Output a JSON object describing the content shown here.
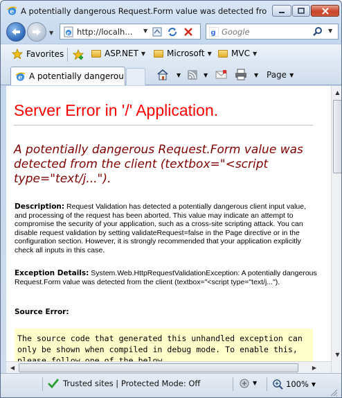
{
  "window": {
    "title": "A potentially dangerous Request.Form value was detected from th..."
  },
  "address_bar": {
    "url": "http://localh...",
    "search_placeholder": "Google"
  },
  "favorites_bar": {
    "favorites_label": "Favorites",
    "items": [
      {
        "label": "ASP.NET",
        "icon": "folder-icon"
      },
      {
        "label": "Microsoft",
        "icon": "folder-icon"
      },
      {
        "label": "MVC",
        "icon": "folder-icon"
      }
    ]
  },
  "tabs": [
    {
      "label": "A potentially dangerous...",
      "active": true
    }
  ],
  "command_bar": {
    "page_label": "Page"
  },
  "page": {
    "heading": "Server Error in '/' Application.",
    "exception_title": "A potentially dangerous Request.Form value was detected from the client (textbox=\"<script type=\"text/j...\").",
    "description_label": "Description:",
    "description_text": "Request Validation has detected a potentially dangerous client input value, and processing of the request has been aborted. This value may indicate an attempt to compromise the security of your application, such as a cross-site scripting attack. You can disable request validation by setting validateRequest=false in the Page directive or in the configuration section. However, it is strongly recommended that your application explicitly check all inputs in this case.",
    "exception_details_label": "Exception Details:",
    "exception_details_text": "System.Web.HttpRequestValidationException: A potentially dangerous Request.Form value was detected from the client (textbox=\"<script type=\"text/j...\").",
    "source_error_label": "Source Error:",
    "source_error_text": "The source code that generated this unhandled exception can only be shown when compiled in debug mode. To enable this, please follow one of the below"
  },
  "status_bar": {
    "zone_text": "Trusted sites | Protected Mode: Off",
    "zoom": "100%"
  },
  "colors": {
    "heading_red": "#ff0000",
    "exception_maroon": "#800000",
    "source_bg": "#ffffcc"
  }
}
